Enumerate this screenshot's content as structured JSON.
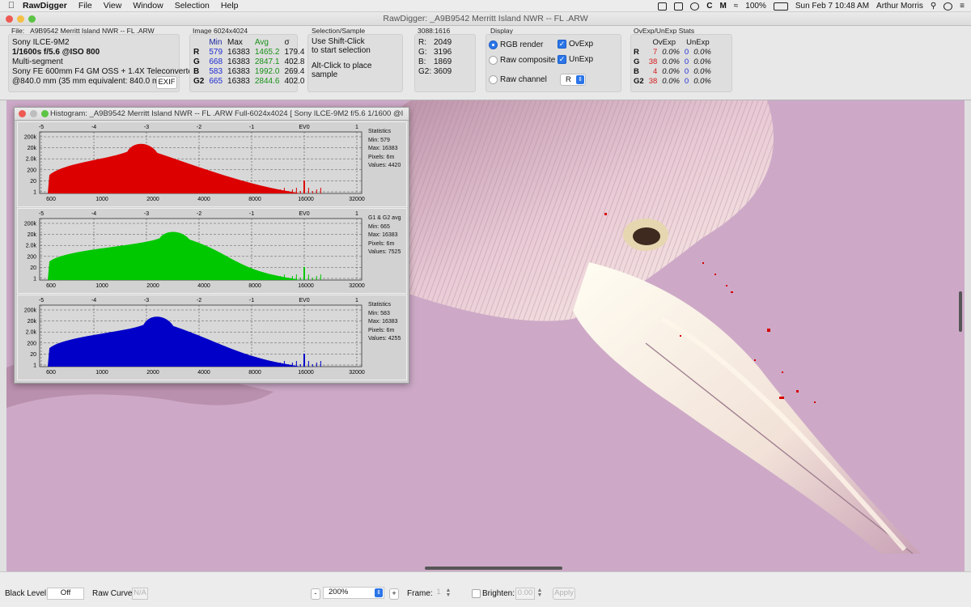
{
  "menubar": {
    "app_name": "RawDigger",
    "menus": [
      "File",
      "View",
      "Window",
      "Selection",
      "Help"
    ],
    "battery": "100%",
    "datetime": "Sun Feb 7  10:48 AM",
    "user": "Arthur Morris"
  },
  "window": {
    "title": "RawDigger: _A9B9542  Merritt Island NWR -- FL .ARW"
  },
  "file_panel": {
    "label": "File: _A9B9542  Merritt Island NWR -- FL .ARW",
    "camera": "Sony ILCE-9M2",
    "exposure": "1/1600s f/5.6 @ISO 800",
    "mode": "Multi-segment",
    "lens": "Sony FE 600mm F4 GM OSS + 1.4X Teleconverter",
    "focal": "@840.0 mm (35 mm equivalent: 840.0 mm)",
    "exif_button": "EXIF"
  },
  "image_panel": {
    "label": "Image 6024x4024",
    "headers": [
      "Min",
      "Max",
      "Avg",
      "σ"
    ],
    "rows": [
      {
        "ch": "R",
        "min": "579",
        "max": "16383",
        "avg": "1465.2",
        "sd": "179.4"
      },
      {
        "ch": "G",
        "min": "668",
        "max": "16383",
        "avg": "2847.1",
        "sd": "402.8"
      },
      {
        "ch": "B",
        "min": "583",
        "max": "16383",
        "avg": "1992.0",
        "sd": "269.4"
      },
      {
        "ch": "G2",
        "min": "665",
        "max": "16383",
        "avg": "2844.6",
        "sd": "402.0"
      }
    ]
  },
  "selection_panel": {
    "label": "Selection/Sample",
    "line1": "Use Shift-Click",
    "line2": "to start selection",
    "line3": "Alt-Click to place",
    "line4": "sample"
  },
  "sample_panel": {
    "label": "3088:1616",
    "rows": [
      {
        "ch": "R:",
        "val": "2049"
      },
      {
        "ch": "G:",
        "val": "3196"
      },
      {
        "ch": "B:",
        "val": "1869"
      },
      {
        "ch": "G2:",
        "val": "3609"
      }
    ]
  },
  "display_panel": {
    "label": "Display",
    "rgb": "RGB render",
    "composite": "Raw composite",
    "rawch": "Raw channel",
    "ovexp": "OvExp",
    "unexp": "UnExp",
    "channel_select": "R",
    "selected": "RGB render",
    "ovexp_checked": true,
    "unexp_checked": true
  },
  "ovexp_panel": {
    "label": "OvExp/UnExp Stats",
    "headers": [
      "OvExp",
      "UnExp"
    ],
    "rows": [
      {
        "ch": "R",
        "ov": "7",
        "ovp": "0.0%",
        "un": "0",
        "unp": "0.0%"
      },
      {
        "ch": "G",
        "ov": "38",
        "ovp": "0.0%",
        "un": "0",
        "unp": "0.0%"
      },
      {
        "ch": "B",
        "ov": "4",
        "ovp": "0.0%",
        "un": "0",
        "unp": "0.0%"
      },
      {
        "ch": "G2",
        "ov": "38",
        "ovp": "0.0%",
        "un": "0",
        "unp": "0.0%"
      }
    ]
  },
  "histogram": {
    "title": "Histogram: _A9B9542  Merritt Island NWR -- FL .ARW Full-6024x4024 [ Sony ILCE-9M2 f/5.6 1/1600 @ISO 8...",
    "ev_labels": [
      "-5",
      "-4",
      "-3",
      "-2",
      "-1",
      "EV0",
      "1"
    ],
    "y_labels": [
      "200k",
      "20k",
      "2.0k",
      "200",
      "20",
      "1"
    ],
    "x_labels": [
      "600",
      "1000",
      "2000",
      "4000",
      "8000",
      "16000",
      "32000"
    ],
    "panels": [
      {
        "channel": "red",
        "color": "#dd0000",
        "stats_title": "Statistics",
        "min": "Min: 579",
        "max": "Max: 16383",
        "pixels": "Pixels: 6m",
        "values": "Values: 4420",
        "peak": [
          0.31,
          0.85
        ]
      },
      {
        "channel": "green",
        "color": "#00c800",
        "stats_title": "G1 & G2 avg",
        "min": "Min: 665",
        "max": "Max: 16383",
        "pixels": "Pixels: 6m",
        "values": "Values: 7525",
        "peak": [
          0.41,
          0.82
        ]
      },
      {
        "channel": "blue",
        "color": "#0000c8",
        "stats_title": "Statistics",
        "min": "Min: 583",
        "max": "Max: 16383",
        "pixels": "Pixels: 6m",
        "values": "Values: 4255",
        "peak": [
          0.36,
          0.86
        ]
      }
    ]
  },
  "bottom": {
    "black_level_label": "Black Level:",
    "black_level_value": "Off",
    "raw_curve_label": "Raw Curve:",
    "raw_curve_value": "N/A",
    "zoom_minus": "-",
    "zoom": "200%",
    "zoom_plus": "+",
    "frame_label": "Frame:",
    "frame_value": "1",
    "brighten_label": "Brighten:",
    "brighten_value": "0.00",
    "apply": "Apply"
  },
  "colors": {
    "photo_bg": "#cda9c7",
    "over_exposed": "#d40000"
  }
}
